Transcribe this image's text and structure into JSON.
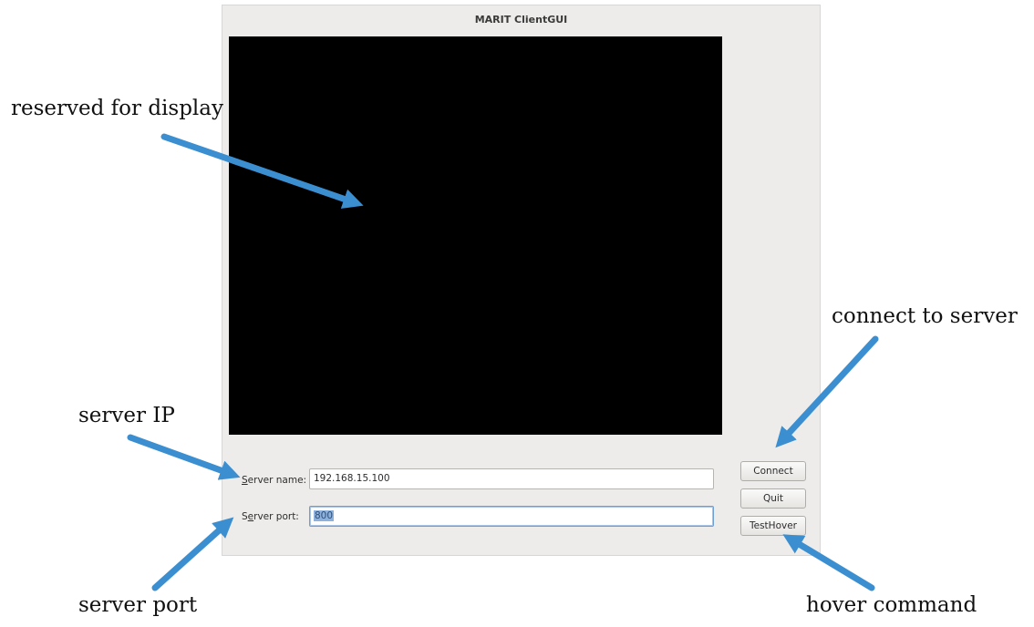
{
  "window": {
    "title": "MARIT ClientGUI"
  },
  "form": {
    "server_name": {
      "mnemonic": "S",
      "label_rest": "erver name:",
      "value": "192.168.15.100"
    },
    "server_port": {
      "label_start": "S",
      "mnemonic": "e",
      "label_rest": "rver port:",
      "value": "800",
      "selected": true
    }
  },
  "buttons": {
    "connect": "Connect",
    "quit": "Quit",
    "test_hover": "TestHover"
  },
  "annotations": {
    "display": "reserved for display",
    "connect": "connect to server",
    "server_ip": "server IP",
    "server_port": "server port",
    "hover": "hover command"
  },
  "colors": {
    "arrow": "#3b8fd1",
    "display_background": "#000000",
    "window_background": "#edecea"
  }
}
